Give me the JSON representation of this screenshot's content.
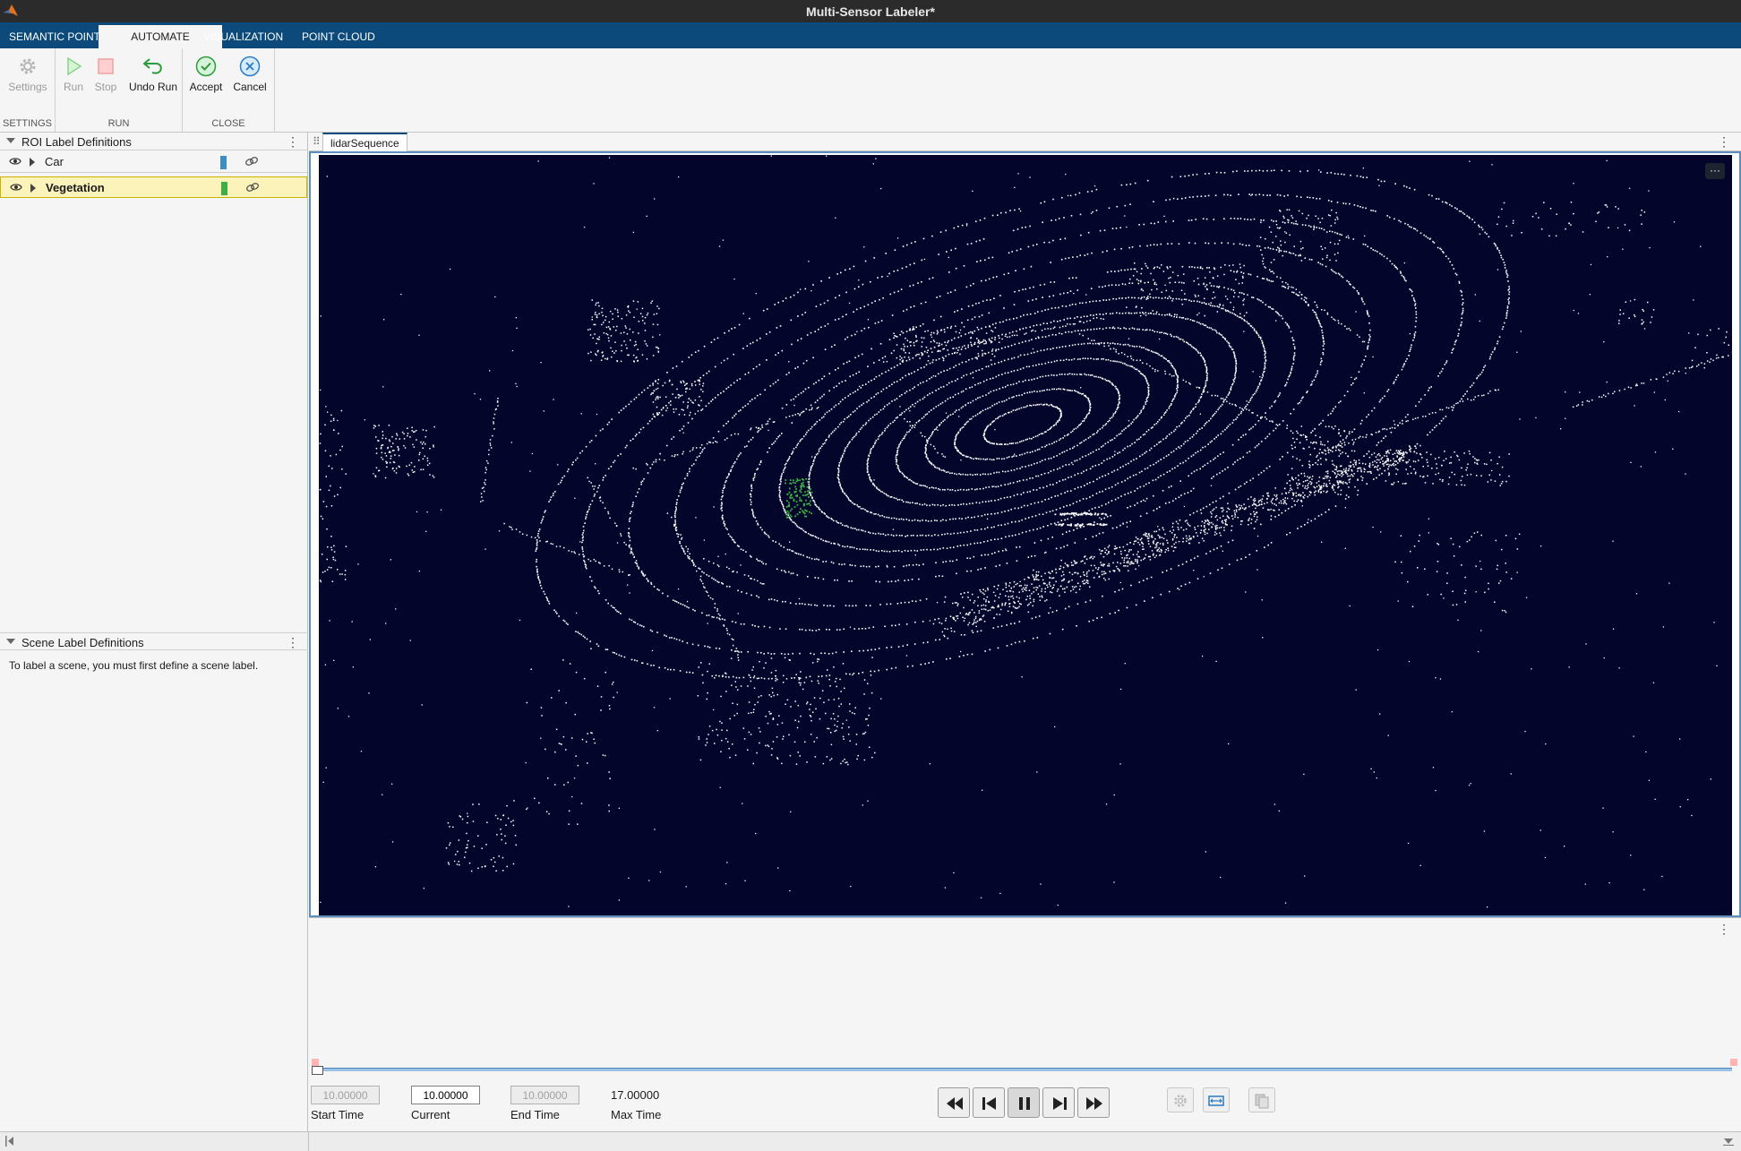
{
  "window": {
    "title": "Multi-Sensor Labeler*"
  },
  "ribbon_tabs": [
    {
      "label": "SEMANTIC POINT"
    },
    {
      "label": "AUTOMATE"
    },
    {
      "label": "VISUALIZATION"
    },
    {
      "label": "POINT CLOUD"
    }
  ],
  "toolstrip": {
    "settings": {
      "section": "SETTINGS",
      "button": "Settings"
    },
    "run": {
      "section": "RUN",
      "run": "Run",
      "stop": "Stop",
      "undo": "Undo Run"
    },
    "close": {
      "section": "CLOSE",
      "accept": "Accept",
      "cancel": "Cancel"
    }
  },
  "roi_panel": {
    "title": "ROI Label Definitions",
    "labels": [
      {
        "name": "Car",
        "color": "#3d8fc0"
      },
      {
        "name": "Vegetation",
        "color": "#3cb043"
      }
    ]
  },
  "scene_panel": {
    "title": "Scene Label Definitions",
    "message": "To label a scene, you must first define a scene label."
  },
  "display": {
    "tab_label": "lidarSequence",
    "background": "#03052b",
    "point_color": "#ffffff",
    "labeled_point_color": "#3cb043"
  },
  "time": {
    "start": "10.00000",
    "current": "10.00000",
    "end": "10.00000",
    "max": "17.00000",
    "start_label": "Start Time",
    "current_label": "Current",
    "end_label": "End Time",
    "max_label": "Max Time"
  }
}
